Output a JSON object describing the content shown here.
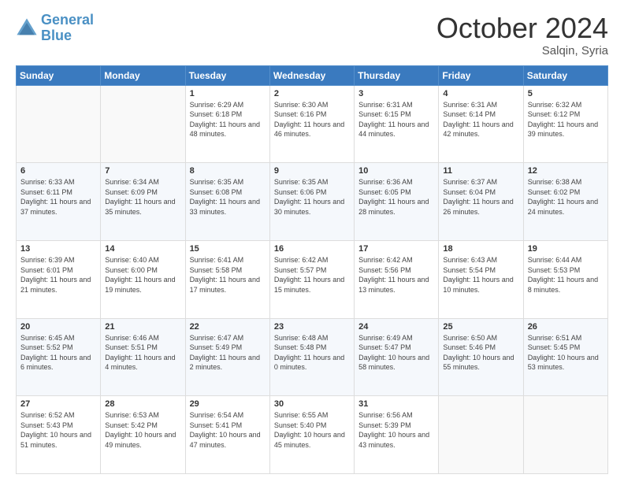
{
  "header": {
    "logo_line1": "General",
    "logo_line2": "Blue",
    "month": "October 2024",
    "location": "Salqin, Syria"
  },
  "weekdays": [
    "Sunday",
    "Monday",
    "Tuesday",
    "Wednesday",
    "Thursday",
    "Friday",
    "Saturday"
  ],
  "weeks": [
    [
      {
        "day": "",
        "info": ""
      },
      {
        "day": "",
        "info": ""
      },
      {
        "day": "1",
        "info": "Sunrise: 6:29 AM\nSunset: 6:18 PM\nDaylight: 11 hours and 48 minutes."
      },
      {
        "day": "2",
        "info": "Sunrise: 6:30 AM\nSunset: 6:16 PM\nDaylight: 11 hours and 46 minutes."
      },
      {
        "day": "3",
        "info": "Sunrise: 6:31 AM\nSunset: 6:15 PM\nDaylight: 11 hours and 44 minutes."
      },
      {
        "day": "4",
        "info": "Sunrise: 6:31 AM\nSunset: 6:14 PM\nDaylight: 11 hours and 42 minutes."
      },
      {
        "day": "5",
        "info": "Sunrise: 6:32 AM\nSunset: 6:12 PM\nDaylight: 11 hours and 39 minutes."
      }
    ],
    [
      {
        "day": "6",
        "info": "Sunrise: 6:33 AM\nSunset: 6:11 PM\nDaylight: 11 hours and 37 minutes."
      },
      {
        "day": "7",
        "info": "Sunrise: 6:34 AM\nSunset: 6:09 PM\nDaylight: 11 hours and 35 minutes."
      },
      {
        "day": "8",
        "info": "Sunrise: 6:35 AM\nSunset: 6:08 PM\nDaylight: 11 hours and 33 minutes."
      },
      {
        "day": "9",
        "info": "Sunrise: 6:35 AM\nSunset: 6:06 PM\nDaylight: 11 hours and 30 minutes."
      },
      {
        "day": "10",
        "info": "Sunrise: 6:36 AM\nSunset: 6:05 PM\nDaylight: 11 hours and 28 minutes."
      },
      {
        "day": "11",
        "info": "Sunrise: 6:37 AM\nSunset: 6:04 PM\nDaylight: 11 hours and 26 minutes."
      },
      {
        "day": "12",
        "info": "Sunrise: 6:38 AM\nSunset: 6:02 PM\nDaylight: 11 hours and 24 minutes."
      }
    ],
    [
      {
        "day": "13",
        "info": "Sunrise: 6:39 AM\nSunset: 6:01 PM\nDaylight: 11 hours and 21 minutes."
      },
      {
        "day": "14",
        "info": "Sunrise: 6:40 AM\nSunset: 6:00 PM\nDaylight: 11 hours and 19 minutes."
      },
      {
        "day": "15",
        "info": "Sunrise: 6:41 AM\nSunset: 5:58 PM\nDaylight: 11 hours and 17 minutes."
      },
      {
        "day": "16",
        "info": "Sunrise: 6:42 AM\nSunset: 5:57 PM\nDaylight: 11 hours and 15 minutes."
      },
      {
        "day": "17",
        "info": "Sunrise: 6:42 AM\nSunset: 5:56 PM\nDaylight: 11 hours and 13 minutes."
      },
      {
        "day": "18",
        "info": "Sunrise: 6:43 AM\nSunset: 5:54 PM\nDaylight: 11 hours and 10 minutes."
      },
      {
        "day": "19",
        "info": "Sunrise: 6:44 AM\nSunset: 5:53 PM\nDaylight: 11 hours and 8 minutes."
      }
    ],
    [
      {
        "day": "20",
        "info": "Sunrise: 6:45 AM\nSunset: 5:52 PM\nDaylight: 11 hours and 6 minutes."
      },
      {
        "day": "21",
        "info": "Sunrise: 6:46 AM\nSunset: 5:51 PM\nDaylight: 11 hours and 4 minutes."
      },
      {
        "day": "22",
        "info": "Sunrise: 6:47 AM\nSunset: 5:49 PM\nDaylight: 11 hours and 2 minutes."
      },
      {
        "day": "23",
        "info": "Sunrise: 6:48 AM\nSunset: 5:48 PM\nDaylight: 11 hours and 0 minutes."
      },
      {
        "day": "24",
        "info": "Sunrise: 6:49 AM\nSunset: 5:47 PM\nDaylight: 10 hours and 58 minutes."
      },
      {
        "day": "25",
        "info": "Sunrise: 6:50 AM\nSunset: 5:46 PM\nDaylight: 10 hours and 55 minutes."
      },
      {
        "day": "26",
        "info": "Sunrise: 6:51 AM\nSunset: 5:45 PM\nDaylight: 10 hours and 53 minutes."
      }
    ],
    [
      {
        "day": "27",
        "info": "Sunrise: 6:52 AM\nSunset: 5:43 PM\nDaylight: 10 hours and 51 minutes."
      },
      {
        "day": "28",
        "info": "Sunrise: 6:53 AM\nSunset: 5:42 PM\nDaylight: 10 hours and 49 minutes."
      },
      {
        "day": "29",
        "info": "Sunrise: 6:54 AM\nSunset: 5:41 PM\nDaylight: 10 hours and 47 minutes."
      },
      {
        "day": "30",
        "info": "Sunrise: 6:55 AM\nSunset: 5:40 PM\nDaylight: 10 hours and 45 minutes."
      },
      {
        "day": "31",
        "info": "Sunrise: 6:56 AM\nSunset: 5:39 PM\nDaylight: 10 hours and 43 minutes."
      },
      {
        "day": "",
        "info": ""
      },
      {
        "day": "",
        "info": ""
      }
    ]
  ]
}
